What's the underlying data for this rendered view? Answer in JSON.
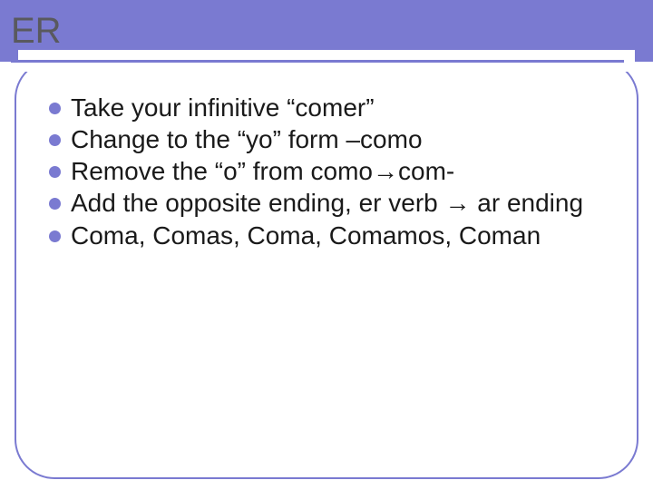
{
  "slide": {
    "title": "ER",
    "bullets": [
      "Take your infinitive “comer”",
      "Change to the “yo” form –como",
      "Remove the “o” from como→com-",
      "Add the opposite ending, er verb → ar ending",
      "Coma, Comas, Coma, Comamos, Coman"
    ]
  }
}
